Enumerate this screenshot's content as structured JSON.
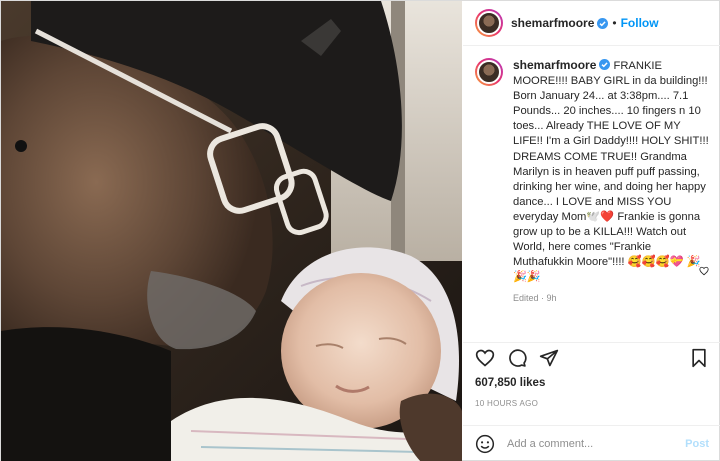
{
  "header": {
    "username": "shemarfmoore",
    "separator": "•",
    "follow_label": "Follow"
  },
  "caption": {
    "username": "shemarfmoore",
    "text": "FRANKIE MOORE!!!! BABY GIRL in da building!!! Born January 24... at 3:38pm.... 7.1 Pounds... 20 inches.... 10 fingers n 10 toes... Already THE LOVE OF MY LIFE!! I'm a Girl Daddy!!!! HOLY SHIT!!! DREAMS COME TRUE!! Grandma Marilyn is in heaven puff puff passing, drinking her wine, and doing her happy dance... I LOVE and MISS YOU everyday Mom🕊️❤️ Frankie is gonna grow up to be a KILLA!!! Watch out World, here comes \"Frankie Muthafukkin Moore\"!!!! 🥰🥰🥰💝 🎉🎉🎉",
    "meta": "Edited · 9h"
  },
  "stats": {
    "likes": "607,850 likes",
    "time_ago": "10 HOURS AGO"
  },
  "comment": {
    "placeholder": "Add a comment...",
    "post_label": "Post"
  },
  "icons": {
    "verified": "verified-badge-icon",
    "like": "heart-icon",
    "comment": "comment-icon",
    "share": "paper-plane-icon",
    "save": "bookmark-icon",
    "emoji": "smiley-icon"
  },
  "colors": {
    "accent": "#0095f6",
    "post_disabled": "#b2dffc",
    "muted": "#8e8e8e",
    "text": "#262626",
    "border": "#dbdbdb"
  }
}
